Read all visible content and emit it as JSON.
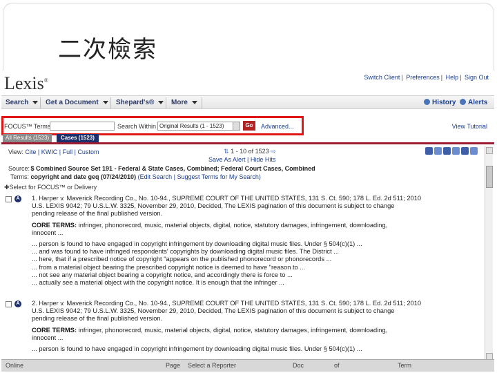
{
  "slide": {
    "title": "二次檢索"
  },
  "header": {
    "logo": "Lexis",
    "logo_mark": "®",
    "links": [
      "Switch Client",
      "Preferences",
      "Help",
      "Sign Out"
    ]
  },
  "nav": {
    "items": [
      "Search",
      "Get a Document",
      "Shepard's®",
      "More"
    ],
    "history": "History",
    "alerts": "Alerts"
  },
  "focus": {
    "label": "FOCUS™ Terms",
    "input_value": "",
    "search_within_label": "Search Within",
    "select_value": "Original Results (1 - 1523)",
    "go_label": "Go",
    "advanced_link": "Advanced...",
    "view_tutorial": "View Tutorial"
  },
  "tabs": {
    "all_results": "All Results  (1523)",
    "cases": "Cases  (1523)"
  },
  "view": {
    "label": "View:",
    "options": [
      "Cite",
      "KWIC",
      "Full",
      "Custom"
    ],
    "paging": "1 - 10 of 1523",
    "save_alert": "Save As Alert",
    "hide_hits": "Hide Hits"
  },
  "source": {
    "source_label": "Source:",
    "source_value": "$ Combined Source Set 191",
    "source_desc": "- Federal & State Cases, Combined; Federal Court Cases, Combined",
    "terms_label": "Terms:",
    "terms_value": "copyright and date geq (07/24/2010)",
    "edit_search": "Edit Search",
    "suggest_terms": "Suggest Terms for My Search",
    "select_focus": "Select for FOCUS™ or Delivery"
  },
  "results": [
    {
      "number": "1.",
      "lines": [
        "1. Harper v. Maverick Recording Co., No. 10-94., SUPREME COURT OF THE UNITED STATES, 131 S. Ct. 590; 178 L. Ed. 2d 511; 2010",
        "U.S. LEXIS 9042; 79 U.S.L.W. 3325, November 29, 2010, Decided,  The LEXIS pagination of this document is subject to change",
        "pending release of the final published version."
      ],
      "core_terms_label": "CORE TERMS:",
      "core_terms": "infringer, phonorecord, music, material objects, digital, notice, statutory damages, infringement, downloading,",
      "core_terms_2": "innocent ...",
      "hits": [
        "... person is found to have engaged in copyright infringement by downloading digital music files. Under § 504(c)(1) ...",
        "... and was found to have infringed respondents' copyrights by downloading digital music files. The District ...",
        "... here, that if a prescribed notice of copyright \"appears on the published phonorecord or phonorecords ...",
        "... from a material object bearing the prescribed copyright notice is deemed to have \"reason to ...",
        "... not see any material object bearing a copyright notice, and accordingly there is force to ...",
        "... actually see a material object with the copyright notice. It is enough that the infringer ..."
      ]
    },
    {
      "number": "2.",
      "lines": [
        "2. Harper v. Maverick Recording Co., No. 10-94., SUPREME COURT OF THE UNITED STATES, 131 S. Ct. 590; 178 L. Ed. 2d 511; 2010",
        "U.S. LEXIS 9042; 79 U.S.L.W. 3325, November 29, 2010, Decided,  The LEXIS pagination of this document is subject to change",
        "pending release of the final published version."
      ],
      "core_terms_label": "CORE TERMS:",
      "core_terms": "infringer, phonorecord, music, material objects, digital, notice, statutory damages, infringement, downloading,",
      "core_terms_2": "innocent ...",
      "hits": [
        "... person is found to have engaged in copyright infringement by downloading digital music files. Under § 504(c)(1) ..."
      ]
    }
  ],
  "footer": {
    "online": "Online",
    "page": "Page",
    "reporter": "Select a Reporter",
    "doc": "Doc",
    "of": "of",
    "term": "Term"
  }
}
